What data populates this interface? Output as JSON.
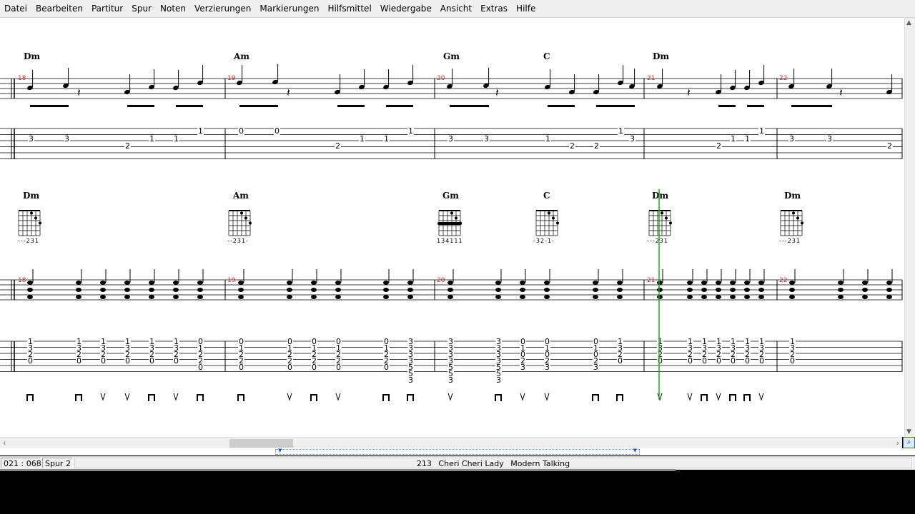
{
  "menu": [
    "Datei",
    "Bearbeiten",
    "Partitur",
    "Spur",
    "Noten",
    "Verzierungen",
    "Markierungen",
    "Hilfsmittel",
    "Wiedergabe",
    "Ansicht",
    "Extras",
    "Hilfe"
  ],
  "colors": {
    "measure_number": "#c03030",
    "cursor": "#22aa22",
    "ink": "#000000"
  },
  "system1": {
    "chords": [
      "Dm",
      "Am",
      "Gm",
      "C",
      "Dm"
    ],
    "measures": [
      "18",
      "19",
      "20",
      "21",
      "22"
    ],
    "tab_numbers": [
      "3",
      "3",
      "2",
      "1",
      "1",
      "1",
      "0",
      "0",
      "2",
      "1",
      "1",
      "1",
      "3",
      "3",
      "1",
      "2",
      "2",
      "1",
      "3",
      "2",
      "1",
      "1",
      "1",
      "3",
      "3",
      "2"
    ]
  },
  "system2": {
    "chords": [
      "Dm",
      "Am",
      "Gm",
      "C",
      "Dm",
      "Dm"
    ],
    "fingerings": [
      "---231",
      "--231-",
      "134111",
      "-32-1-",
      "---231",
      "---231"
    ],
    "measures": [
      "18",
      "19",
      "20",
      "21",
      "22"
    ],
    "tab_columns": [
      [
        "1",
        "3",
        "2",
        "0"
      ],
      [
        "1",
        "3",
        "2",
        "0"
      ],
      [
        "1",
        "3",
        "2",
        "0"
      ],
      [
        "1",
        "3",
        "2",
        "0"
      ],
      [
        "1",
        "3",
        "2",
        "0"
      ],
      [
        "1",
        "3",
        "2",
        "0"
      ],
      [
        "0",
        "1",
        "2",
        "2",
        "0"
      ],
      [
        "0",
        "1",
        "2",
        "2",
        "0"
      ],
      [
        "0",
        "1",
        "2",
        "2",
        "0"
      ],
      [
        "0",
        "1",
        "2",
        "2",
        "0"
      ],
      [
        "0",
        "1",
        "2",
        "2",
        "0"
      ],
      [
        "0",
        "1",
        "2",
        "2",
        "0"
      ],
      [
        "3",
        "3",
        "3",
        "3",
        "5",
        "5",
        "3"
      ],
      [
        "3",
        "3",
        "3",
        "3",
        "5",
        "5",
        "3"
      ],
      [
        "3",
        "3",
        "3",
        "3",
        "5",
        "5",
        "3"
      ],
      [
        "0",
        "1",
        "0",
        "2",
        "3"
      ],
      [
        "0",
        "1",
        "0",
        "2",
        "3"
      ],
      [
        "0",
        "1",
        "0",
        "2",
        "3"
      ],
      [
        "1",
        "3",
        "2",
        "0"
      ],
      [
        "1",
        "3",
        "2",
        "0"
      ],
      [
        "1",
        "3",
        "2",
        "0"
      ],
      [
        "1",
        "3",
        "2",
        "0"
      ],
      [
        "1",
        "3",
        "2",
        "0"
      ],
      [
        "1",
        "3",
        "2",
        "0"
      ],
      [
        "1",
        "3",
        "2",
        "0"
      ],
      [
        "1",
        "3",
        "2",
        "0"
      ],
      [
        "1",
        "3",
        "2",
        "0"
      ]
    ],
    "strokes": [
      "down",
      "down",
      "up",
      "up",
      "down",
      "up",
      "down",
      "down",
      "up",
      "down",
      "up",
      "down",
      "down",
      "up",
      "down",
      "up",
      "up",
      "down",
      "down",
      "up",
      "up",
      "down",
      "up",
      "down",
      "down",
      "up"
    ]
  },
  "status": {
    "position": "021 : 068",
    "track": "Spur 2",
    "song_number": "213",
    "song_title": "Cheri Cheri Lady",
    "song_artist": "Modern Talking"
  }
}
